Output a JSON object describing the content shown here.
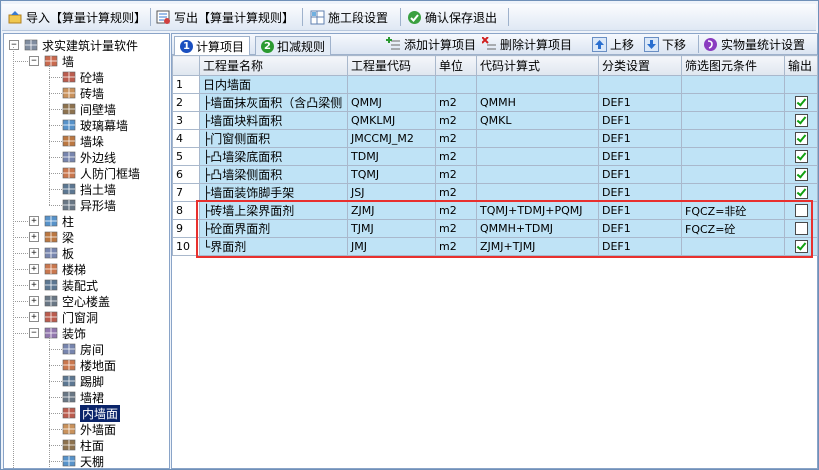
{
  "toolbar": {
    "import_label": "导入【算量计算规则】",
    "export_label": "写出【算量计算规则】",
    "stage_label": "施工段设置",
    "confirm_label": "确认保存退出"
  },
  "tree": {
    "root_label": "求实建筑计量软件",
    "wall_label": "墙",
    "wall_children": [
      "砼墙",
      "砖墙",
      "间壁墙",
      "玻璃幕墙",
      "墙垛",
      "外边线",
      "人防门框墙",
      "挡土墙",
      "异形墙"
    ],
    "groups": [
      "柱",
      "梁",
      "板",
      "楼梯",
      "装配式",
      "空心楼盖",
      "门窗洞"
    ],
    "decor_label": "装饰",
    "decor_children": [
      "房间",
      "楼地面",
      "踢脚",
      "墙裙",
      "内墙面",
      "外墙面",
      "柱面",
      "天棚"
    ],
    "selected": "内墙面"
  },
  "tabs": [
    {
      "num": "1",
      "label": "计算项目"
    },
    {
      "num": "2",
      "label": "扣减规则"
    }
  ],
  "actions": {
    "add_label": "添加计算项目",
    "delete_label": "删除计算项目",
    "up_label": "上移",
    "down_label": "下移",
    "stats_label": "实物量统计设置"
  },
  "grid": {
    "headers": [
      "",
      "工程量名称",
      "工程量代码",
      "单位",
      "代码计算式",
      "分类设置",
      "筛选图元条件",
      "输出"
    ],
    "rows": [
      {
        "n": "1",
        "name": "日内墙面",
        "code": "",
        "unit": "",
        "formula": "",
        "cls": "",
        "filter": "",
        "out": null
      },
      {
        "n": "2",
        "name": "├墙面抹灰面积（含凸梁侧",
        "code": "QMMJ",
        "unit": "m2",
        "formula": "QMMH",
        "cls": "DEF1",
        "filter": "",
        "out": true
      },
      {
        "n": "3",
        "name": "├墙面块料面积",
        "code": "QMKLMJ",
        "unit": "m2",
        "formula": "QMKL",
        "cls": "DEF1",
        "filter": "",
        "out": true
      },
      {
        "n": "4",
        "name": "├门窗侧面积",
        "code": "JMCCMJ_M2",
        "unit": "m2",
        "formula": "",
        "cls": "DEF1",
        "filter": "",
        "out": true
      },
      {
        "n": "5",
        "name": "├凸墙梁底面积",
        "code": "TDMJ",
        "unit": "m2",
        "formula": "",
        "cls": "DEF1",
        "filter": "",
        "out": true
      },
      {
        "n": "6",
        "name": "├凸墙梁侧面积",
        "code": "TQMJ",
        "unit": "m2",
        "formula": "",
        "cls": "DEF1",
        "filter": "",
        "out": true
      },
      {
        "n": "7",
        "name": "├墙面装饰脚手架",
        "code": "JSJ",
        "unit": "m2",
        "formula": "",
        "cls": "DEF1",
        "filter": "",
        "out": true
      },
      {
        "n": "8",
        "name": "├砖墙上梁界面剂",
        "code": "ZJMJ",
        "unit": "m2",
        "formula": "TQMJ+TDMJ+PQMJ",
        "cls": "DEF1",
        "filter": "FQCZ=非砼",
        "out": false
      },
      {
        "n": "9",
        "name": "├砼面界面剂",
        "code": "TJMJ",
        "unit": "m2",
        "formula": "QMMH+TDMJ",
        "cls": "DEF1",
        "filter": "FQCZ=砼",
        "out": false
      },
      {
        "n": "10",
        "name": "└界面剂",
        "code": "JMJ",
        "unit": "m2",
        "formula": "ZJMJ+TJMJ",
        "cls": "DEF1",
        "filter": "",
        "out": true
      }
    ]
  }
}
